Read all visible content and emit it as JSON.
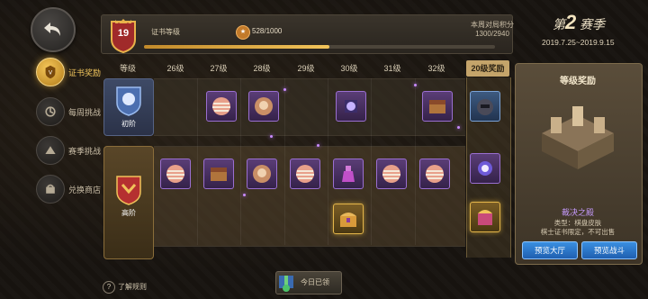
{
  "sidebar": {
    "items": [
      {
        "label": "证书奖励",
        "icon": "certificate-icon",
        "active": true
      },
      {
        "label": "每周挑战",
        "icon": "weekly-icon",
        "active": false
      },
      {
        "label": "赛季挑战",
        "icon": "season-icon",
        "active": false
      },
      {
        "label": "兑换商店",
        "icon": "shop-icon",
        "active": false
      }
    ]
  },
  "header": {
    "level": "19",
    "level_title": "证书等级",
    "xp_text": "528/1000",
    "xp_progress": 0.528,
    "week_label": "本周对局积分",
    "week_value": "1300/2940",
    "season_prefix": "第",
    "season_num": "2",
    "season_suffix": "赛季",
    "season_dates": "2019.7.25~2019.9.15"
  },
  "grid": {
    "level_header": "等级",
    "columns": [
      "26级",
      "27级",
      "28级",
      "29级",
      "30级",
      "31级",
      "32级"
    ],
    "reward_header": "20级奖励",
    "basic_tier": "初阶",
    "advanced_tier": "高阶"
  },
  "panel": {
    "title": "等级奖励",
    "item_name": "裁决之殿",
    "item_type": "类型：棋盘皮肤",
    "item_note": "棋士证书限定，不可出售",
    "btn_lobby": "预览大厅",
    "btn_battle": "预览战斗"
  },
  "footer": {
    "help": "了解规则",
    "claim": "今日已领"
  },
  "colors": {
    "accent_gold": "#f2c45a",
    "button_blue": "#2f7fd6",
    "epic_purple": "#9a6fd0"
  }
}
